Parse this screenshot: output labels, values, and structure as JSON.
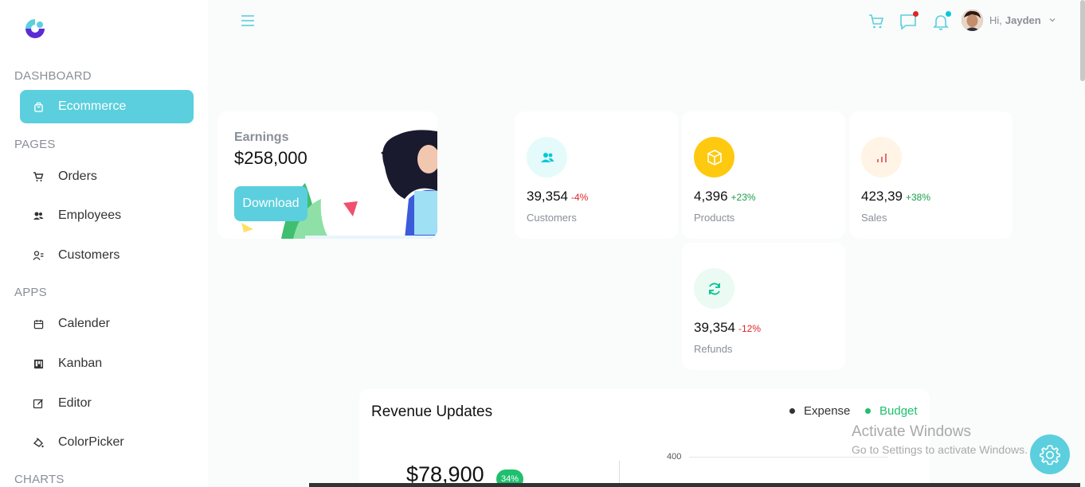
{
  "sidebar": {
    "sections": [
      {
        "title": "DASHBOARD"
      },
      {
        "title": "PAGES"
      },
      {
        "title": "APPS"
      },
      {
        "title": "CHARTS"
      }
    ],
    "items": [
      {
        "label": "Ecommerce",
        "icon": "shopping-bag-icon"
      },
      {
        "label": "Orders",
        "icon": "cart-icon"
      },
      {
        "label": "Employees",
        "icon": "users-icon"
      },
      {
        "label": "Customers",
        "icon": "user-list-icon"
      },
      {
        "label": "Calender",
        "icon": "calendar-icon"
      },
      {
        "label": "Kanban",
        "icon": "kanban-icon"
      },
      {
        "label": "Editor",
        "icon": "edit-icon"
      },
      {
        "label": "ColorPicker",
        "icon": "color-picker-icon"
      }
    ]
  },
  "header": {
    "greeting": "Hi,",
    "username": "Jayden",
    "icons": [
      "menu-icon",
      "cart-icon",
      "chat-icon",
      "bell-icon"
    ]
  },
  "earnings": {
    "title": "Earnings",
    "value": "$258,000",
    "button": "Download"
  },
  "stats": [
    {
      "value": "39,354",
      "change": "-4%",
      "label": "Customers",
      "icon": "users-icon",
      "bg": "#e5fafb",
      "fg": "#03c9d7",
      "trend": "#e02424"
    },
    {
      "value": "4,396",
      "change": "+23%",
      "label": "Products",
      "icon": "box-icon",
      "bg": "#fec90f",
      "fg": "#ffffff",
      "trend": "#1a9e4b"
    },
    {
      "value": "423,39",
      "change": "+38%",
      "label": "Sales",
      "icon": "bar-chart-icon",
      "bg": "#fff4e5",
      "fg": "#e46a76",
      "trend": "#1a9e4b"
    },
    {
      "value": "39,354",
      "change": "-12%",
      "label": "Refunds",
      "icon": "refresh-icon",
      "bg": "#ebfaf2",
      "fg": "#00c292",
      "trend": "#e02424"
    }
  ],
  "revenue": {
    "title": "Revenue Updates",
    "legend": [
      {
        "label": "Expense",
        "color": "#333333"
      },
      {
        "label": "Budget",
        "color": "#1ec06e"
      }
    ],
    "amount": "$78,900",
    "badge": "34%",
    "tick": "400"
  },
  "watermark": {
    "line1": "Activate Windows",
    "line2": "Go to Settings to activate Windows."
  },
  "colors": {
    "accent": "#5bcfdd"
  }
}
